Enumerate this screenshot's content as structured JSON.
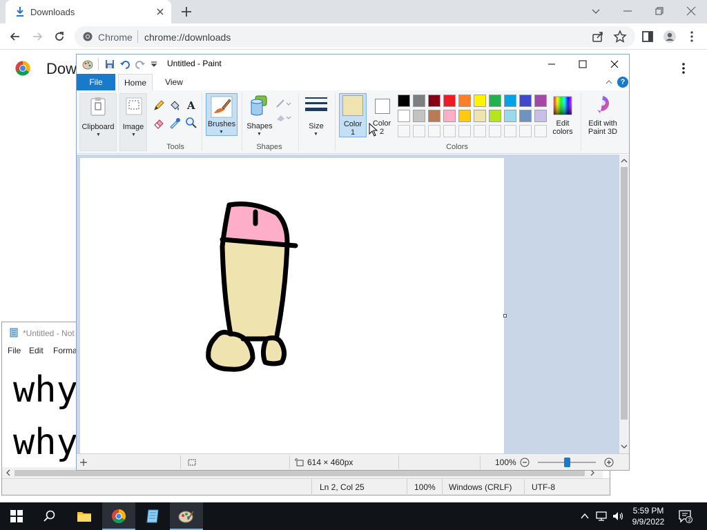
{
  "chrome": {
    "tab_title": "Downloads",
    "omnibox_site": "Chrome",
    "omnibox_url": "chrome://downloads",
    "page_heading": "Dow"
  },
  "notepad": {
    "title": "*Untitled - Not",
    "menu": [
      "File",
      "Edit",
      "Forma"
    ],
    "text_lines": [
      "why",
      "why"
    ],
    "status": {
      "position": "Ln 2, Col 25",
      "zoom": "100%",
      "line_ending": "Windows (CRLF)",
      "encoding": "UTF-8"
    }
  },
  "paint": {
    "title": "Untitled - Paint",
    "tabs": {
      "file": "File",
      "home": "Home",
      "view": "View"
    },
    "ribbon": {
      "clipboard": "Clipboard",
      "image": "Image",
      "tools": "Tools",
      "brushes": "Brushes",
      "shapes_btn": "Shapes",
      "shapes_group": "Shapes",
      "size": "Size",
      "color1_line1": "Color",
      "color1_line2": "1",
      "color2_line1": "Color",
      "color2_line2": "2",
      "colors_group": "Colors",
      "edit_colors_line1": "Edit",
      "edit_colors_line2": "colors",
      "paint3d_line1": "Edit with",
      "paint3d_line2": "Paint 3D"
    },
    "color1": "#efe4b0",
    "color2": "#ffffff",
    "palette_row1": [
      "#000000",
      "#7f7f7f",
      "#880015",
      "#ed1c24",
      "#ff7f27",
      "#fff200",
      "#22b14c",
      "#00a2e8",
      "#3f48cc",
      "#a349a4"
    ],
    "palette_row2": [
      "#ffffff",
      "#c3c3c3",
      "#b97a57",
      "#ffaec9",
      "#ffc90e",
      "#efe4b0",
      "#b5e61d",
      "#99d9ea",
      "#7092be",
      "#c8bfe7"
    ],
    "drawing_colors": {
      "outline": "#000000",
      "top": "#ffaec9",
      "body": "#efe4b0"
    },
    "status": {
      "canvas_size": "614 × 460px",
      "zoom": "100%"
    }
  },
  "taskbar": {
    "time": "5:59 PM",
    "date": "9/9/2022"
  }
}
